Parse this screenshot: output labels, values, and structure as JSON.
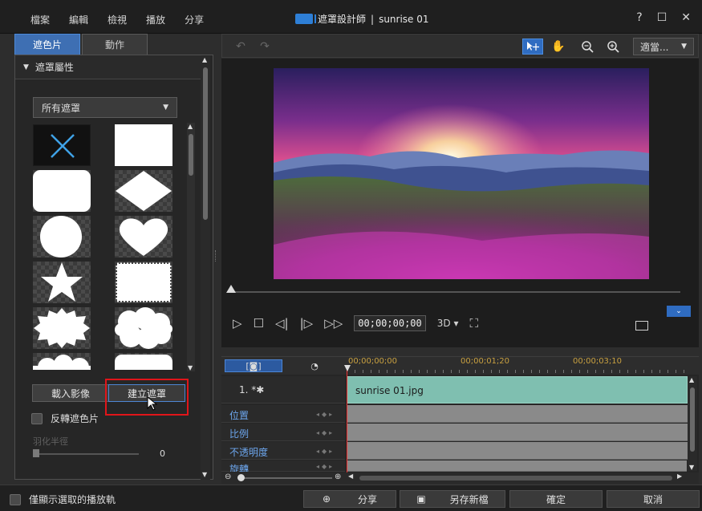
{
  "window": {
    "app_title": "遮罩設計師",
    "separator": "|",
    "project_name": "sunrise 01"
  },
  "menu": [
    "檔案",
    "編輯",
    "檢視",
    "播放",
    "分享"
  ],
  "window_controls": {
    "help": "?",
    "maximize": "☐",
    "close": "✕"
  },
  "left_panel": {
    "tabs": [
      "遮色片",
      "動作"
    ],
    "section_title": "遮罩屬性",
    "mask_filter": "所有遮罩",
    "mask_shapes": [
      "x-none",
      "rectangle",
      "rounded-rectangle",
      "diamond",
      "circle",
      "heart",
      "star",
      "stamp",
      "burst",
      "cloud",
      "cloud-partial",
      "rectangle-partial"
    ],
    "import_button": "載入影像",
    "create_mask_button": "建立遮罩",
    "invert_label": "反轉遮色片",
    "feather_label": "羽化半徑",
    "feather_value": "0"
  },
  "toolbar": {
    "zoom_fit_label": "適當..."
  },
  "player": {
    "timecode": "00;00;00;00",
    "mode_3d": "3D"
  },
  "timeline": {
    "ruler_ticks": [
      "00;00;00;00",
      "00;00;01;20",
      "00;00;03;10"
    ],
    "clip_track_label": "1. *✱",
    "clip_name": "sunrise 01.jpg",
    "property_tracks": [
      "位置",
      "比例",
      "不透明度",
      "旋轉"
    ]
  },
  "bottom": {
    "show_selected_label": "僅顯示選取的播放軌",
    "share_label": "分享",
    "save_new_label": "另存新檔",
    "ok_label": "確定",
    "cancel_label": "取消"
  },
  "colors": {
    "accent": "#3e6fb3",
    "highlight_box": "#e0151a",
    "clip": "#7fbfb0"
  }
}
